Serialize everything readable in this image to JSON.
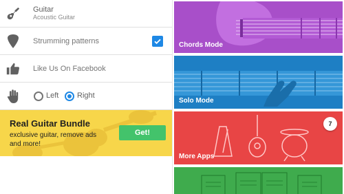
{
  "settings": {
    "instrument": {
      "title": "Guitar",
      "subtitle": "Acoustic Guitar",
      "icon": "guitar-icon"
    },
    "strumming": {
      "label": "Strumming patterns",
      "checked": true,
      "icon": "pick-icon"
    },
    "facebook": {
      "label": "Like Us On Facebook",
      "icon": "thumbs-up-icon"
    },
    "hand": {
      "icon": "hand-icon",
      "left_label": "Left",
      "right_label": "Right",
      "selected": "Right"
    }
  },
  "banner": {
    "title": "Real Guitar Bundle",
    "subtitle": "exclusive guitar, remove ads and more!",
    "button": "Get!",
    "colors": {
      "background": "#f7d64a",
      "button": "#43c36b"
    }
  },
  "tiles": [
    {
      "label": "Chords Mode",
      "color": "#a84fc9"
    },
    {
      "label": "Solo Mode",
      "color": "#1e7fc4"
    },
    {
      "label": "More Apps",
      "color": "#e84545",
      "badge": "7"
    },
    {
      "label": "",
      "color": "#3fab4d"
    }
  ]
}
